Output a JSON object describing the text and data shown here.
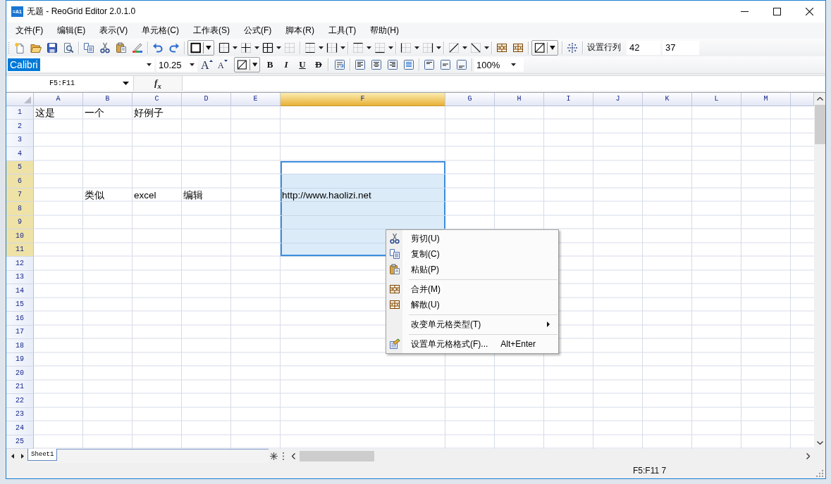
{
  "window": {
    "icon_text": "=A1",
    "title": "无题 - ReoGrid Editor 2.0.1.0"
  },
  "menu_bar": [
    "文件(F)",
    "编辑(E)",
    "表示(V)",
    "单元格(C)",
    "工作表(S)",
    "公式(F)",
    "脚本(R)",
    "工具(T)",
    "帮助(H)"
  ],
  "toolbar": {
    "row_col_label": "设置行列",
    "row_count": "42",
    "column_count": "37"
  },
  "format_toolbar": {
    "font": {
      "value": "Calibri",
      "selected": true
    },
    "font_size": "10.25",
    "font_size_buttons": [
      {
        "kind": "grow",
        "label": "A"
      },
      {
        "kind": "shrink",
        "label": "A"
      }
    ],
    "style_buttons": [
      {
        "kind": "bold",
        "label": "B"
      },
      {
        "kind": "italic",
        "label": "I"
      },
      {
        "kind": "underline",
        "label": "U"
      },
      {
        "kind": "strikethrough",
        "label": "D"
      }
    ],
    "zoom": "100%"
  },
  "formula_bar": {
    "address": "F5:F11",
    "function_button": "f$_{x}$"
  },
  "grid": {
    "columns": [
      {
        "label": "A",
        "selected": false
      },
      {
        "label": "B",
        "selected": false
      },
      {
        "label": "C",
        "selected": false
      },
      {
        "label": "D",
        "selected": false
      },
      {
        "label": "E",
        "selected": false
      },
      {
        "label": "F",
        "selected": true
      },
      {
        "label": "G",
        "selected": false
      },
      {
        "label": "H",
        "selected": false
      },
      {
        "label": "I",
        "selected": false
      },
      {
        "label": "J",
        "selected": false
      },
      {
        "label": "K",
        "selected": false
      },
      {
        "label": "L",
        "selected": false
      },
      {
        "label": "M",
        "selected": false
      }
    ],
    "rows": [
      {
        "label": "1",
        "selected": false,
        "cells": [
          "这是",
          "一个",
          "好例子"
        ]
      },
      {
        "label": "2",
        "selected": false
      },
      {
        "label": "3",
        "selected": false
      },
      {
        "label": "4",
        "selected": false
      },
      {
        "label": "5",
        "selected": true
      },
      {
        "label": "6",
        "selected": true
      },
      {
        "label": "7",
        "selected": true,
        "cells": [
          null,
          "类似",
          "excel",
          "编辑",
          null,
          "http://www.haolizi.net"
        ]
      },
      {
        "label": "8",
        "selected": true
      },
      {
        "label": "9",
        "selected": true
      },
      {
        "label": "10",
        "selected": true
      },
      {
        "label": "11",
        "selected": true
      },
      {
        "label": "12",
        "selected": false
      },
      {
        "label": "13",
        "selected": false
      },
      {
        "label": "14",
        "selected": false
      },
      {
        "label": "15",
        "selected": false
      },
      {
        "label": "16",
        "selected": false
      },
      {
        "label": "17",
        "selected": false
      },
      {
        "label": "18",
        "selected": false
      },
      {
        "label": "19",
        "selected": false
      },
      {
        "label": "20",
        "selected": false
      },
      {
        "label": "21",
        "selected": false
      },
      {
        "label": "22",
        "selected": false
      },
      {
        "label": "23",
        "selected": false
      },
      {
        "label": "24",
        "selected": false
      },
      {
        "label": "25",
        "selected": false
      }
    ]
  },
  "sheet_tabs": [
    {
      "label": "Sheet1",
      "selected": true
    }
  ],
  "context_menu": {
    "items": [
      {
        "kind": "command",
        "label": "剪切(U)"
      },
      {
        "kind": "command",
        "label": "复制(C)"
      },
      {
        "kind": "command",
        "label": "粘贴(P)"
      },
      {
        "kind": "separator"
      },
      {
        "kind": "command",
        "label": "合并(M)"
      },
      {
        "kind": "command",
        "label": "解散(U)"
      },
      {
        "kind": "separator"
      },
      {
        "kind": "submenu",
        "label": "改变单元格类型(T)"
      },
      {
        "kind": "separator"
      },
      {
        "kind": "command",
        "label": "设置单元格格式(F)...",
        "shortcut": "Alt+Enter"
      }
    ]
  },
  "status_bar": {
    "text": "F5:F11 7"
  }
}
